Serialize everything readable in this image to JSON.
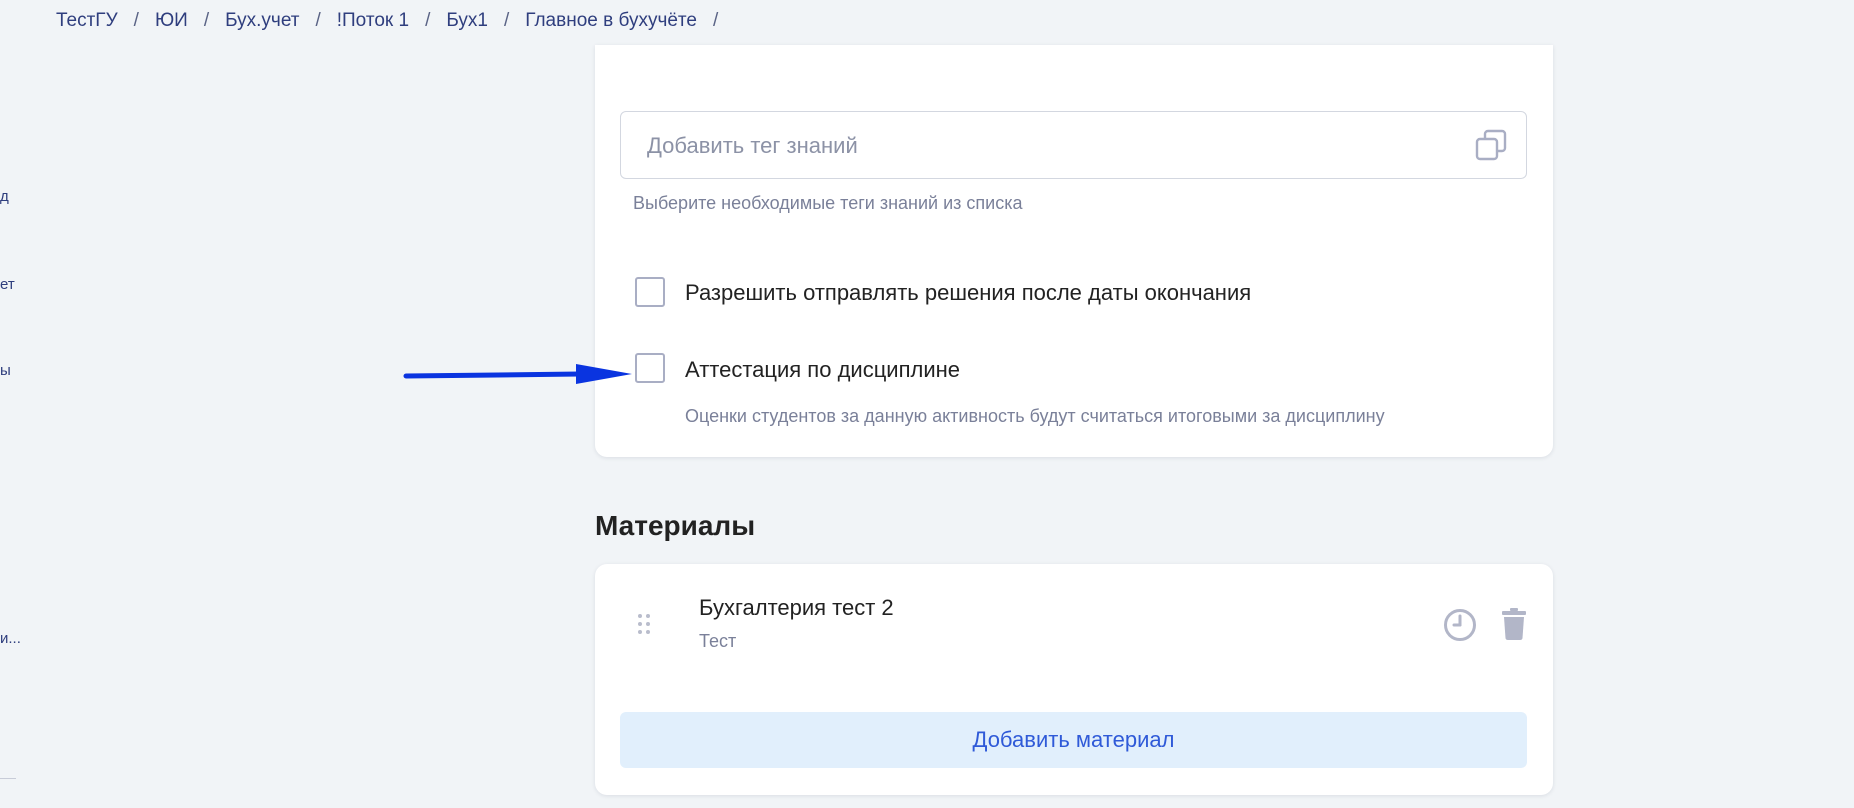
{
  "breadcrumb": {
    "items": [
      "ТестГУ",
      "ЮИ",
      "Бух.учет",
      "!Поток 1",
      "Бух1",
      "Главное в бухучёте"
    ],
    "separator": "/"
  },
  "sidebar": {
    "fragments": [
      "д",
      "ет",
      "ы",
      "и..."
    ]
  },
  "settings": {
    "tag_input_placeholder": "Добавить тег знаний",
    "tag_helper": "Выберите необходимые теги знаний из списка",
    "allow_late_label": "Разрешить отправлять решения после даты окончания",
    "allow_late_checked": false,
    "attestation_label": "Аттестация по дисциплине",
    "attestation_checked": false,
    "attestation_desc": "Оценки студентов за данную активность будут считаться итоговыми за дисциплину"
  },
  "materials": {
    "section_title": "Материалы",
    "items": [
      {
        "title": "Бухгалтерия тест 2",
        "type": "Тест"
      }
    ],
    "add_button": "Добавить материал"
  },
  "colors": {
    "accent": "#2f5ad8",
    "arrow": "#0a34e0",
    "link": "#2f3e7e",
    "background": "#f1f4f7"
  },
  "icons": [
    "copy-icon",
    "drag-handle-icon",
    "clock-icon",
    "trash-icon",
    "arrow-icon"
  ]
}
